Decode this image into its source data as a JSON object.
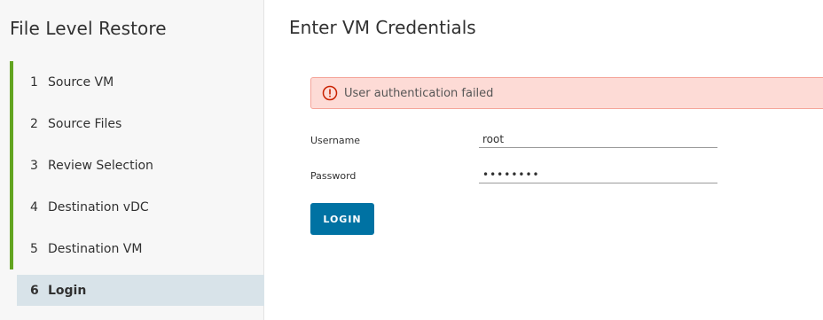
{
  "sidebar": {
    "title": "File Level Restore",
    "steps": [
      {
        "num": "1",
        "label": "Source VM"
      },
      {
        "num": "2",
        "label": "Source Files"
      },
      {
        "num": "3",
        "label": "Review Selection"
      },
      {
        "num": "4",
        "label": "Destination vDC"
      },
      {
        "num": "5",
        "label": "Destination VM"
      },
      {
        "num": "6",
        "label": "Login"
      }
    ]
  },
  "main": {
    "title": "Enter VM Credentials",
    "alert": {
      "text": "User authentication failed",
      "icon": "error-circle-icon",
      "color": "#c92100"
    },
    "username": {
      "label": "Username",
      "value": "root"
    },
    "password": {
      "label": "Password",
      "value": "••••••••"
    },
    "login_label": "LOGIN"
  },
  "colors": {
    "accent": "#0072a3",
    "completed": "#62a420",
    "active_step_bg": "#d8e3e9",
    "alert_bg": "#fddbd6"
  }
}
